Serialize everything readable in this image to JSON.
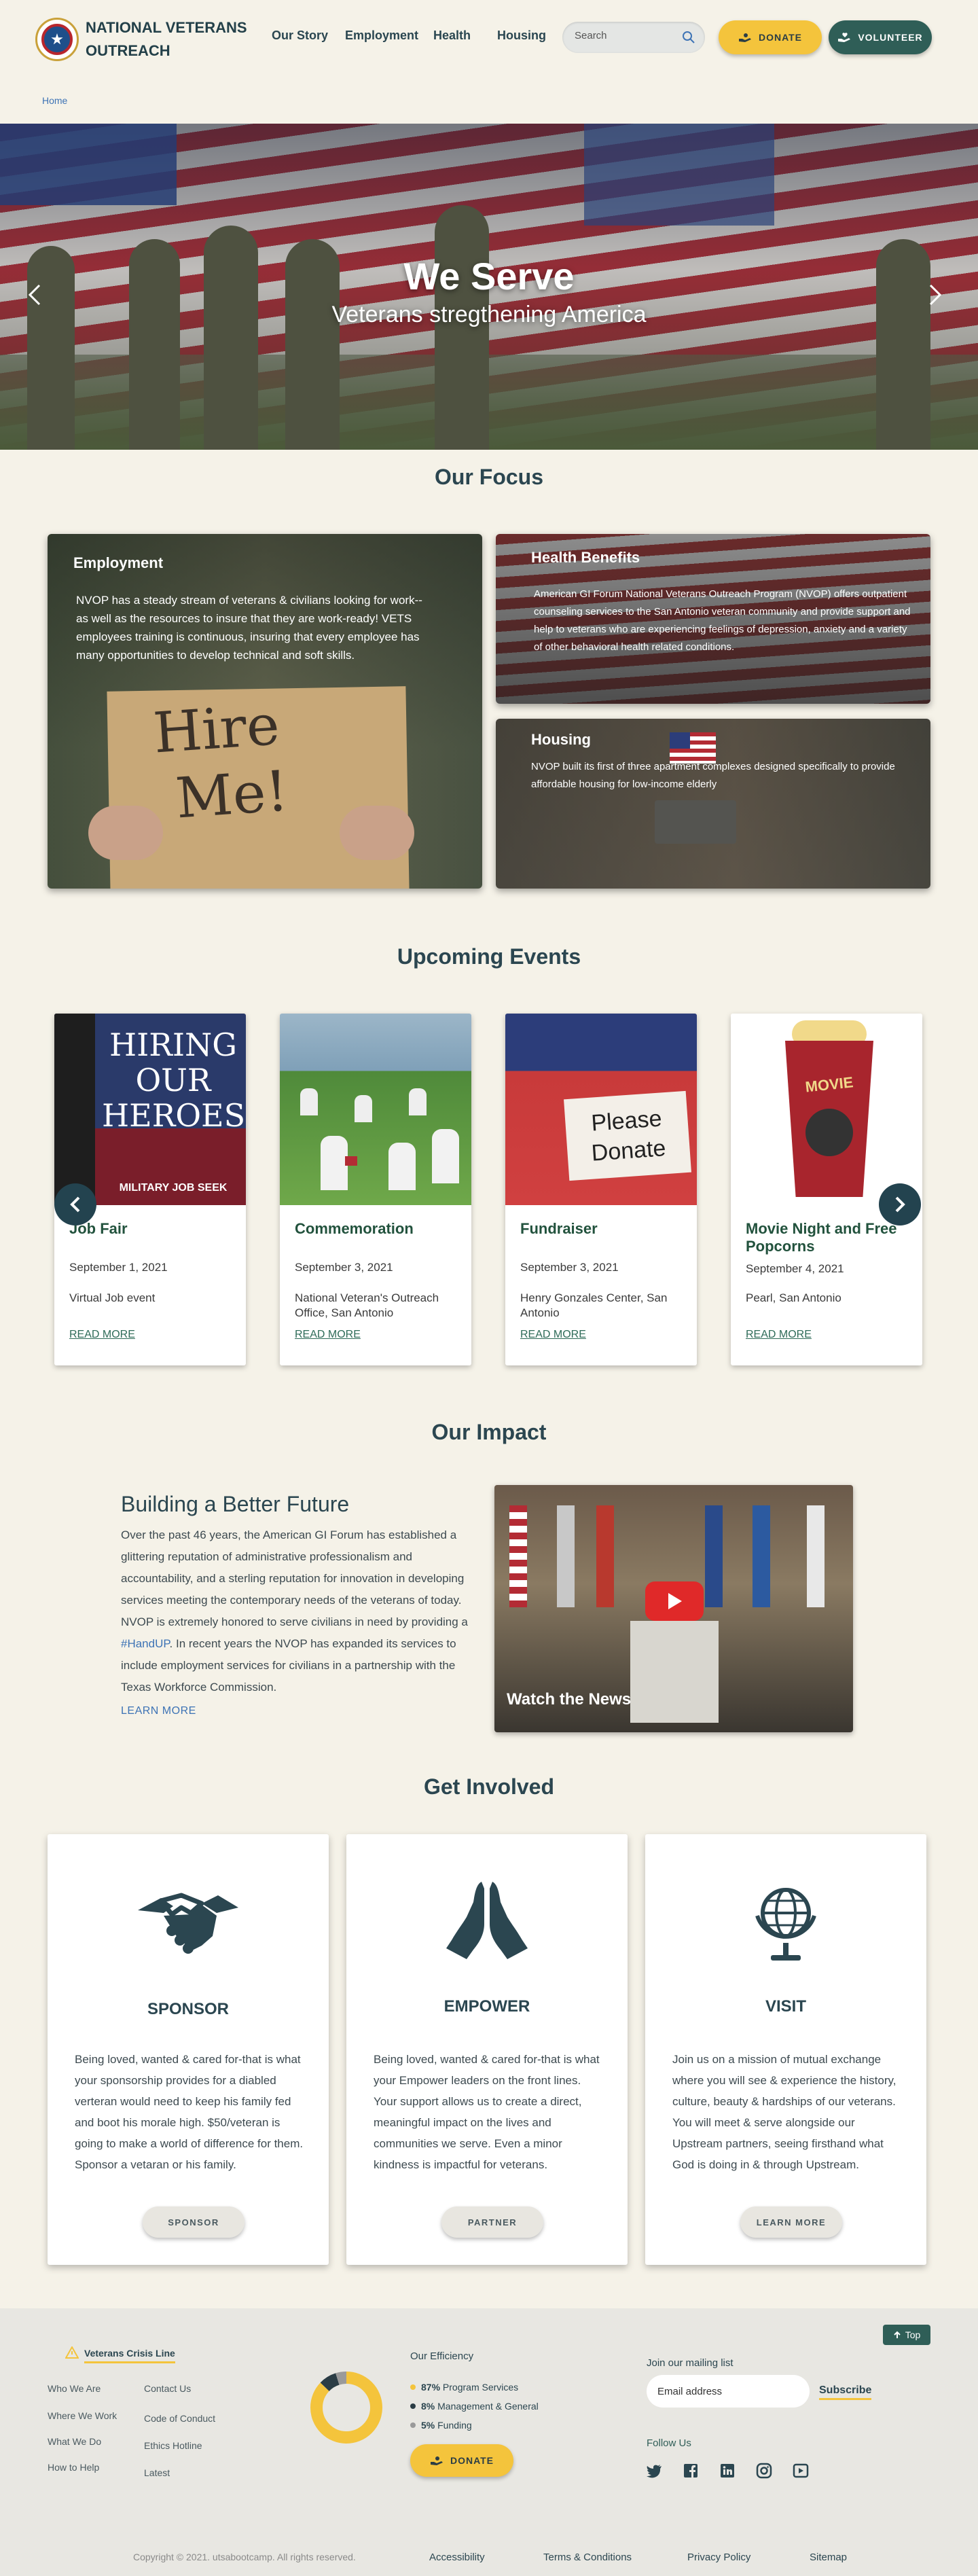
{
  "header": {
    "site_title": "NATIONAL VETERANS OUTREACH",
    "nav": [
      "Our Story",
      "Employment",
      "Health",
      "Housing"
    ],
    "search_placeholder": "Search",
    "donate_label": "DONATE",
    "volunteer_label": "VOLUNTEER"
  },
  "breadcrumb": "Home",
  "hero": {
    "title": "We Serve",
    "subtitle": "Veterans stregthening America"
  },
  "focus": {
    "heading": "Our Focus",
    "cards": [
      {
        "title": "Employment",
        "text": "NVOP has a steady stream of veterans & civilians looking for work--as well as the resources to insure that they are work-ready! VETS employees training is continuous, insuring that every employee has many opportunities to develop technical and soft skills.",
        "sign_line1": "Hire",
        "sign_line2": "Me!"
      },
      {
        "title": "Health Benefits",
        "text": "American GI Forum National Veterans Outreach Program (NVOP) offers outpatient counseling services to the San Antonio veteran community and provide support and help to veterans who are experiencing feelings of depression, anxiety and a variety of other behavioral health related conditions."
      },
      {
        "title": "Housing",
        "text": "NVOP built its first of three apartment complexes designed specifically to provide affordable housing for low-income elderly"
      }
    ]
  },
  "events": {
    "heading": "Upcoming Events",
    "items": [
      {
        "title": "Job Fair",
        "date": "September 1, 2021",
        "location": "Virtual Job event",
        "more": "READ MORE",
        "image_text": [
          "HIRING",
          "OUR",
          "HEROES",
          "MILITARY JOB SEEK"
        ]
      },
      {
        "title": "Commemoration",
        "date": "September 3, 2021",
        "location": "National Veteran's Outreach Office, San Antonio",
        "more": "READ MORE"
      },
      {
        "title": "Fundraiser",
        "date": "September 3, 2021",
        "location": "Henry Gonzales Center, San Antonio",
        "more": "READ MORE",
        "image_text": [
          "Please",
          "Donate"
        ]
      },
      {
        "title": "Movie Night and Free Popcorns",
        "date": "September 4, 2021",
        "location": "Pearl, San Antonio",
        "more": "READ MORE",
        "image_text": [
          "MOVIE"
        ]
      }
    ]
  },
  "impact": {
    "section_heading": "Our Impact",
    "heading": "Building a Better Future",
    "text_before": "Over the past 46 years, the American GI Forum has established a glittering reputation of administrative professionalism and accountability, and a sterling reputation for innovation in developing services meeting the contemporary needs of the veterans of today. NVOP is extremely honored to serve civilians in need by providing a ",
    "hashtag": "#HandUP",
    "text_after": ". In recent years the NVOP has expanded its services to include employment services for civilians in a partnership with the Texas Workforce Commission.",
    "link": "LEARN MORE",
    "video_label": "Watch the News"
  },
  "involved": {
    "heading": "Get Involved",
    "cards": [
      {
        "icon": "handshake-icon",
        "title": "SPONSOR",
        "text": "Being loved, wanted & cared for-that is what your sponsorship provides for a diabled verteran would need to keep his family fed and boot his morale high. $50/veteran is going to make a world of difference for them. Sponsor a vetaran or his family.",
        "button": "SPONSOR"
      },
      {
        "icon": "praying-hands-icon",
        "title": "EMPOWER",
        "text": "Being loved, wanted & cared for-that is what your Empower leaders on the front lines. Your support allows us to create a direct, meaningful impact on the lives and communities we serve. Even a minor kindness is impactful for veterans.",
        "button": "PARTNER"
      },
      {
        "icon": "globe-icon",
        "title": "VISIT",
        "text": "Join us on a mission of mutual exchange where you will see & experience the history, culture, beauty & hardships of our veterans. You will meet & serve alongside our Upstream partners, seeing firsthand what God is doing in & through Upstream.",
        "button": "LEARN MORE"
      }
    ]
  },
  "footer": {
    "top_label": "Top",
    "crisis_line": "Veterans Crisis Line",
    "col1": [
      "Who We Are",
      "Where We Work",
      "What We Do",
      "How to Help"
    ],
    "col2": [
      "Contact Us",
      "Code of Conduct",
      "Ethics Hotline",
      "Latest"
    ],
    "efficiency_title": "Our Efficiency",
    "efficiency": [
      {
        "percent": "87%",
        "label": "Program Services",
        "value": 87,
        "color": "#f4c43c"
      },
      {
        "percent": "8%",
        "label": "Management & General",
        "value": 8,
        "color": "#2b3d45"
      },
      {
        "percent": "5%",
        "label": "Funding",
        "value": 5,
        "color": "#9a9a9a"
      }
    ],
    "donate_label": "DONATE",
    "mailing_title": "Join our mailing list",
    "email_placeholder": "Email address",
    "subscribe_label": "Subscribe",
    "follow_label": "Follow Us",
    "social": [
      "twitter-icon",
      "facebook-icon",
      "linkedin-icon",
      "instagram-icon",
      "youtube-icon"
    ],
    "copyright": "Copyright © 2021. utsabootcamp. All rights reserved.",
    "bottom_links": [
      "Accessibility",
      "Terms & Conditions",
      "Privacy Policy",
      "Sitemap"
    ]
  }
}
